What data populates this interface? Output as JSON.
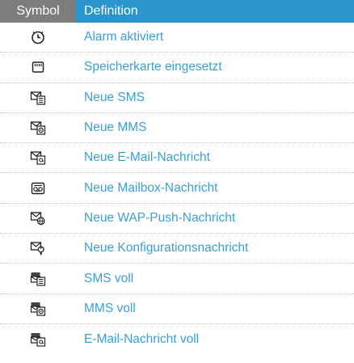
{
  "header": {
    "symbol": "Symbol",
    "definition": "Definition"
  },
  "rows": [
    {
      "icon": "alarm-icon",
      "label": "Alarm aktiviert"
    },
    {
      "icon": "memory-card-icon",
      "label": "Speicherkarte eingesetzt"
    },
    {
      "icon": "new-sms-icon",
      "label": "Neue SMS"
    },
    {
      "icon": "new-mms-icon",
      "label": "Neue MMS"
    },
    {
      "icon": "new-email-icon",
      "label": "Neue E-Mail-Nachricht"
    },
    {
      "icon": "voicemail-icon",
      "label": "Neue Mailbox-Nachricht"
    },
    {
      "icon": "wap-push-icon",
      "label": "Neue WAP-Push-Nachricht"
    },
    {
      "icon": "configuration-message-icon",
      "label": "Neue Konfigurationsnachricht"
    },
    {
      "icon": "sms-full-icon",
      "label": "SMS voll"
    },
    {
      "icon": "mms-full-icon",
      "label": "MMS voll"
    },
    {
      "icon": "email-full-icon",
      "label": "E-Mail-Nachricht voll"
    }
  ],
  "colors": {
    "header_blue": "#2a95cc",
    "header_gray": "#7d7d7d",
    "text_blue": "#3a9fd6"
  }
}
